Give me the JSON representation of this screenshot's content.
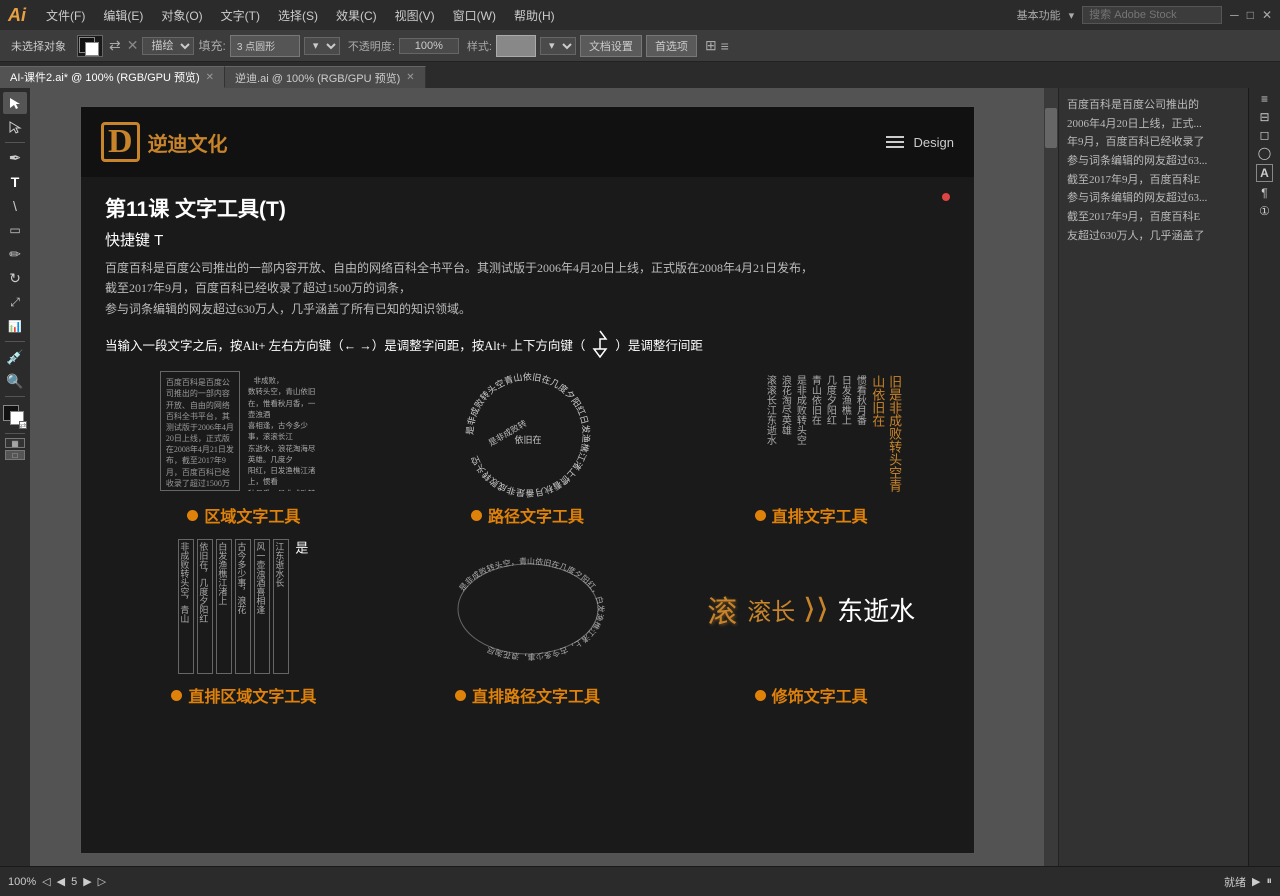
{
  "app": {
    "logo": "Ai",
    "menus": [
      "文件(F)",
      "编辑(E)",
      "对象(O)",
      "文字(T)",
      "选择(S)",
      "效果(C)",
      "视图(V)",
      "窗口(W)",
      "帮助(H)"
    ],
    "right_menu": "基本功能",
    "search_placeholder": "搜索 Adobe Stock"
  },
  "toolbar": {
    "no_selection": "未选择对象",
    "fill_label": "填充:",
    "brush_size": "3 点圆形",
    "opacity_label": "不透明度:",
    "opacity_value": "100%",
    "style_label": "样式:",
    "doc_settings": "文档设置",
    "preferences": "首选项"
  },
  "tabs": [
    {
      "label": "AI-课件2.ai* @ 100% (RGB/GPU 预览)",
      "active": true
    },
    {
      "label": "逆迪.ai @ 100% (RGB/GPU 预览)",
      "active": false
    }
  ],
  "slide": {
    "header_text": "Design",
    "logo_symbol": "D",
    "logo_name": "逆迪文化",
    "title": "第11课   文字工具(T)",
    "shortcut": "快捷键 T",
    "description": "百度百科是百度公司推出的一部内容开放、自由的网络百科全书平台。其测试版于2006年4月20日上线，正式版在2008年4月21日发布，\n截至2017年9月，百度百科已经收录了超过1500万的词条，\n参与词条编辑的网友超过630万人，几乎涵盖了所有已知的知识领域。",
    "tip": "当输入一段文字之后，按Alt+ 左右方向键（← →）是调整字间距，按Alt+ 上下方向键（↑ ↓）是调整行间距",
    "demos": [
      {
        "label": "区域文字工具",
        "type": "area"
      },
      {
        "label": "路径文字工具",
        "type": "path"
      },
      {
        "label": "直排文字工具",
        "type": "vertical"
      }
    ],
    "bottom_demos": [
      {
        "label": "直排区域文字工具",
        "type": "vertical-area"
      },
      {
        "label": "直排路径文字工具",
        "type": "vertical-path"
      },
      {
        "label": "修饰文字工具",
        "type": "decoration"
      }
    ],
    "sample_text": "非成败转头空，青山依旧在，惟看秋月香。一壶浊酒喜相逢，古今多少事，滚滚长江东逝水，浪花淘尽英雄。是非成败转头空，青山依旧在，几度夕阳红。日发渔樵江渚上，惯看秋月番"
  },
  "props_panel": {
    "text": "百度百科是百度公司推出的\n2006年4月20日上线，正式...\n年9月，百度百科已经收录了\n参与词条编辑的网友超过63...\n截至2017年9月，百度百科E\n参与词条编辑的网友超过63...\n截至2017年9月，百度百科E\n友超过630万人，几乎涵盖了"
  },
  "bottom_bar": {
    "zoom": "100%",
    "page": "5",
    "total_pages": "5",
    "status": "就绪"
  }
}
